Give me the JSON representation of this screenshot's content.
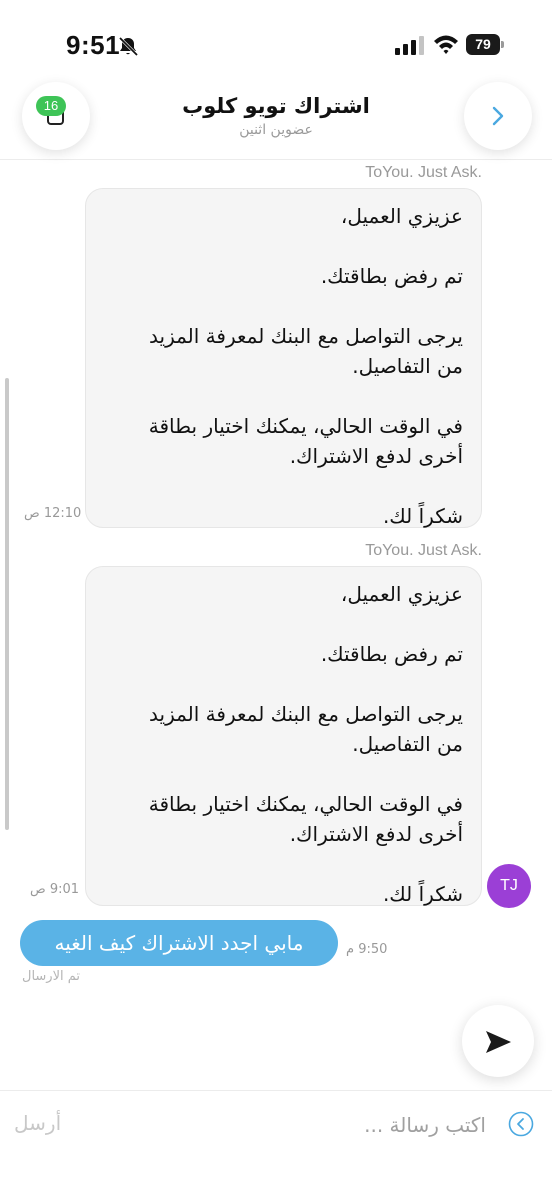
{
  "status_bar": {
    "time": "9:51",
    "battery": "79"
  },
  "header": {
    "title": "اشتراك تويو كلوب",
    "subtitle": "عضوين اثنين",
    "badge": "16"
  },
  "messages": [
    {
      "sender": "ToYou. Just Ask.",
      "lines": [
        "عزيزي العميل،",
        "",
        "تم رفض بطاقتك.",
        "",
        "يرجى التواصل مع البنك لمعرفة المزيد",
        "من التفاصيل.",
        "",
        "في الوقت الحالي، يمكنك اختيار بطاقة",
        "أخرى لدفع الاشتراك.",
        "",
        "شكراً لك."
      ],
      "time": "12:10 ص"
    },
    {
      "sender": "ToYou. Just Ask.",
      "lines": [
        "عزيزي العميل،",
        "",
        "تم رفض بطاقتك.",
        "",
        "يرجى التواصل مع البنك لمعرفة المزيد",
        "من التفاصيل.",
        "",
        "في الوقت الحالي، يمكنك اختيار بطاقة",
        "أخرى لدفع الاشتراك.",
        "",
        "شكراً لك."
      ],
      "time": "9:01 ص",
      "avatar": "TJ"
    }
  ],
  "outgoing": {
    "text": "مابي اجدد الاشتراك كيف الغيه",
    "time": "9:50 م",
    "status": "تم الارسال"
  },
  "composer": {
    "placeholder": "اكتب رسالة ...",
    "send_label": "أرسل"
  },
  "colors": {
    "accent": "#5ab3e6",
    "avatar": "#9b3fd6",
    "badge": "#3ec457"
  }
}
